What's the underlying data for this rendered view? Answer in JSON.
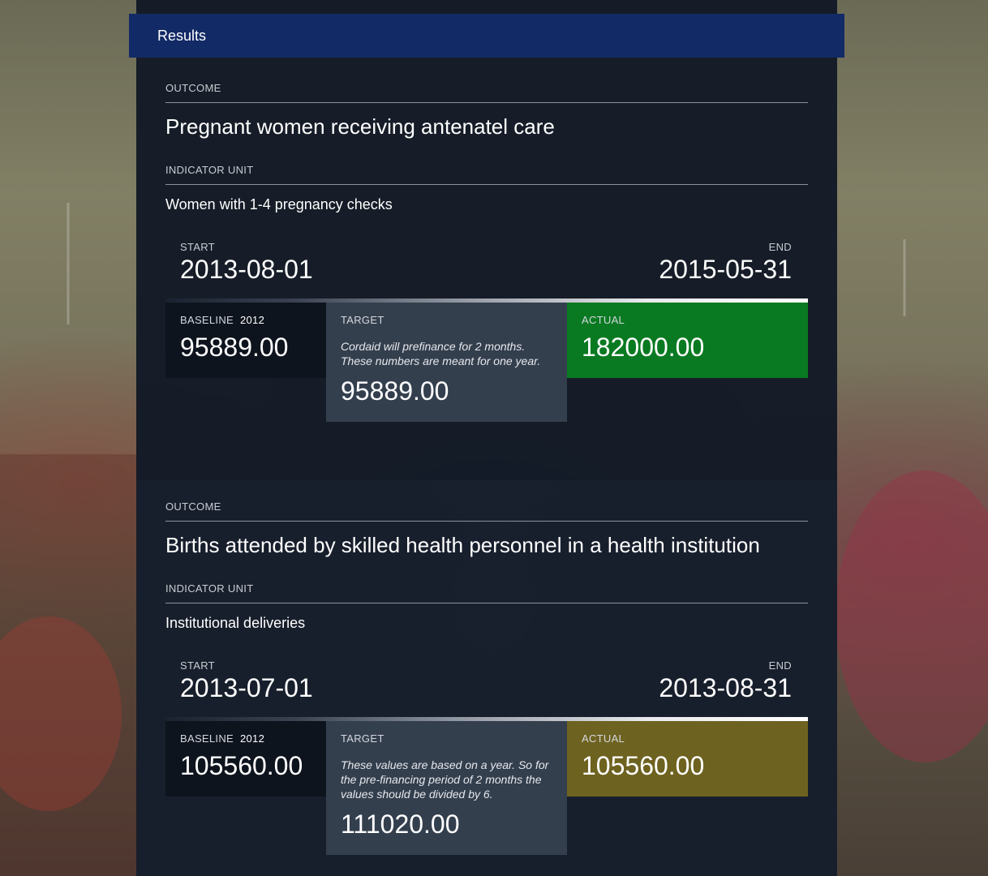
{
  "header": {
    "title": "Results"
  },
  "results": [
    {
      "outcome_label": "OUTCOME",
      "outcome_title": "Pregnant women receiving antenatel care",
      "indicator_label": "INDICATOR UNIT",
      "indicator_value": "Women with 1-4 pregnancy checks",
      "start_label": "START",
      "start_date": "2013-08-01",
      "end_label": "END",
      "end_date": "2015-05-31",
      "baseline_label": "BASELINE",
      "baseline_year": "2012",
      "baseline_value": "95889.00",
      "target_label": "TARGET",
      "target_note": "Cordaid will prefinance for 2 months. These numbers are meant for one year.",
      "target_value": "95889.00",
      "actual_label": "ACTUAL",
      "actual_value": "182000.00",
      "actual_color": "#0a7a22"
    },
    {
      "outcome_label": "OUTCOME",
      "outcome_title": "Births attended by skilled health personnel in a health institution",
      "indicator_label": "INDICATOR UNIT",
      "indicator_value": "Institutional deliveries",
      "start_label": "START",
      "start_date": "2013-07-01",
      "end_label": "END",
      "end_date": "2013-08-31",
      "baseline_label": "BASELINE",
      "baseline_year": "2012",
      "baseline_value": "105560.00",
      "target_label": "TARGET",
      "target_note": "These values are based on a year. So for the pre-financing period of 2 months the values should be divided by 6.",
      "target_value": "111020.00",
      "actual_label": "ACTUAL",
      "actual_value": "105560.00",
      "actual_color": "#6e6220"
    }
  ]
}
